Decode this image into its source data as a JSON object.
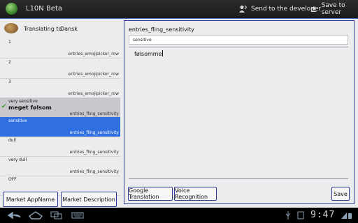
{
  "app": {
    "title": "L10N Beta"
  },
  "actions": {
    "send": "Send to the developer",
    "save": "Save to server"
  },
  "header": {
    "label": "Translating to",
    "language": "Dansk"
  },
  "rows": [
    {
      "src": "1",
      "translation": "",
      "key": "entries_emojipicker_row",
      "state": "normal"
    },
    {
      "src": "2",
      "translation": "",
      "key": "entries_emojipicker_row",
      "state": "normal"
    },
    {
      "src": "3",
      "translation": "",
      "key": "entries_emojipicker_row",
      "state": "normal"
    },
    {
      "src": "very sensitive",
      "translation": "meget følsom",
      "key": "entries_fling_sensitivity",
      "state": "done"
    },
    {
      "src": "sensitive",
      "translation": "",
      "key": "entries_fling_sensitivity",
      "state": "selected"
    },
    {
      "src": "dull",
      "translation": "",
      "key": "entries_fling_sensitivity",
      "state": "normal"
    },
    {
      "src": "very dull",
      "translation": "",
      "key": "entries_fling_sensitivity",
      "state": "normal"
    },
    {
      "src": "OFF",
      "translation": "",
      "key": "",
      "state": "normal"
    }
  ],
  "left_buttons": {
    "appname": "Market AppName",
    "description": "Market Description"
  },
  "editor": {
    "key": "entries_fling_sensitivity",
    "source": "sensitive",
    "translation": "følsomme",
    "google": "Google Translation",
    "voice": "Voice Recognition",
    "save": "Save"
  },
  "system": {
    "clock": "9:47",
    "accent": "#2f6fe0",
    "border": "#2c3a92"
  }
}
